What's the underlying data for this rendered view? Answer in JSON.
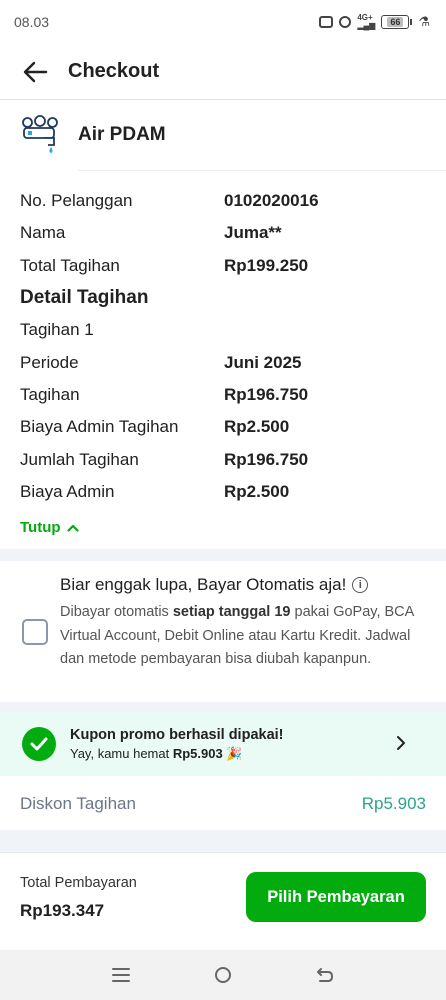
{
  "status_bar": {
    "time": "08.03",
    "network": "4G+",
    "battery_level": "66"
  },
  "header": {
    "title": "Checkout",
    "back_icon": "arrow-left-icon"
  },
  "biller": {
    "name": "Air PDAM",
    "icon": "water-tap-icon"
  },
  "details": {
    "rows": [
      {
        "label": "No. Pelanggan",
        "value": "0102020016"
      },
      {
        "label": "Nama",
        "value": "Juma**"
      },
      {
        "label": "Total Tagihan",
        "value": "Rp199.250"
      }
    ],
    "section_title": "Detail Tagihan",
    "bill_rows": [
      {
        "label": "Tagihan 1",
        "value": ""
      },
      {
        "label": "Periode",
        "value": "Juni 2025"
      },
      {
        "label": "Tagihan",
        "value": "Rp196.750"
      },
      {
        "label": "Biaya Admin Tagihan",
        "value": "Rp2.500"
      },
      {
        "label": "Jumlah Tagihan",
        "value": "Rp196.750"
      },
      {
        "label": "Biaya Admin",
        "value": "Rp2.500"
      }
    ],
    "collapse_label": "Tutup"
  },
  "autopay": {
    "title": "Biar enggak lupa, Bayar Otomatis aja!",
    "desc_prefix": "Dibayar otomatis ",
    "desc_bold": "setiap tanggal 19",
    "desc_suffix": " pakai GoPay, BCA Virtual Account, Debit Online atau Kartu Kredit. Jadwal dan metode pembayaran bisa diubah kapanpun.",
    "checked": false
  },
  "coupon": {
    "title": "Kupon promo berhasil dipakai!",
    "sub_prefix": "Yay, kamu hemat ",
    "sub_amount": "Rp5.903",
    "sub_emoji": "🎉"
  },
  "discount": {
    "label": "Diskon Tagihan",
    "value": "Rp5.903"
  },
  "footer": {
    "total_label": "Total Pembayaran",
    "total_value": "Rp193.347",
    "pay_button": "Pilih Pembayaran"
  },
  "colors": {
    "primary_green": "#03ac0e",
    "discount_green": "#2ba58a",
    "coupon_bg": "#eafaf4",
    "separator_bg": "#f0f3f7"
  }
}
